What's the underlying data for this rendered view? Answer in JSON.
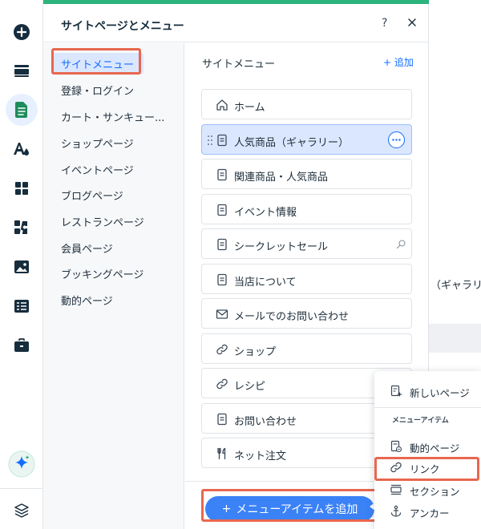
{
  "panel": {
    "title": "サイトページとメニュー",
    "help_label": "?",
    "accent_color": "#2cb47c"
  },
  "categories": [
    {
      "label": "サイトメニュー",
      "selected": true
    },
    {
      "label": "登録・ログイン"
    },
    {
      "label": "カート・サンキュー..."
    },
    {
      "label": "ショップページ"
    },
    {
      "label": "イベントページ"
    },
    {
      "label": "ブログページ"
    },
    {
      "label": "レストランページ"
    },
    {
      "label": "会員ページ"
    },
    {
      "label": "ブッキングページ"
    },
    {
      "label": "動的ページ"
    }
  ],
  "menu": {
    "title": "サイトメニュー",
    "add_label": "+ 追加",
    "items": [
      {
        "label": "ホーム",
        "icon": "home-icon"
      },
      {
        "label": "人気商品（ギャラリー）",
        "icon": "page-icon",
        "selected": true
      },
      {
        "label": "関連商品・人気商品",
        "icon": "page-icon"
      },
      {
        "label": "イベント情報",
        "icon": "page-icon"
      },
      {
        "label": "シークレットセール",
        "icon": "page-icon",
        "hidden": true
      },
      {
        "label": "当店について",
        "icon": "page-icon"
      },
      {
        "label": "メールでのお問い合わせ",
        "icon": "mail-icon"
      },
      {
        "label": "ショップ",
        "icon": "link-icon"
      },
      {
        "label": "レシピ",
        "icon": "link-icon"
      },
      {
        "label": "お問い合わせ",
        "icon": "page-icon"
      },
      {
        "label": "ネット注文",
        "icon": "restaurant-icon"
      }
    ],
    "add_item_button": "メニューアイテムを追加",
    "add_item_plus": "+"
  },
  "dropdown": {
    "new_page": "新しいページ",
    "section_header": "メニューアイテム",
    "items": [
      {
        "label": "動的ページ",
        "icon": "dynamic-page-icon"
      },
      {
        "label": "リンク",
        "icon": "link-icon",
        "highlighted": true
      },
      {
        "label": "セクション",
        "icon": "section-icon"
      },
      {
        "label": "アンカー",
        "icon": "anchor-icon"
      }
    ]
  },
  "background": {
    "gallery_text": "（ギャラリー"
  },
  "colors": {
    "accent_blue": "#116dff",
    "highlight_red": "#e8674f",
    "selected_bg": "#dbe7ff"
  }
}
